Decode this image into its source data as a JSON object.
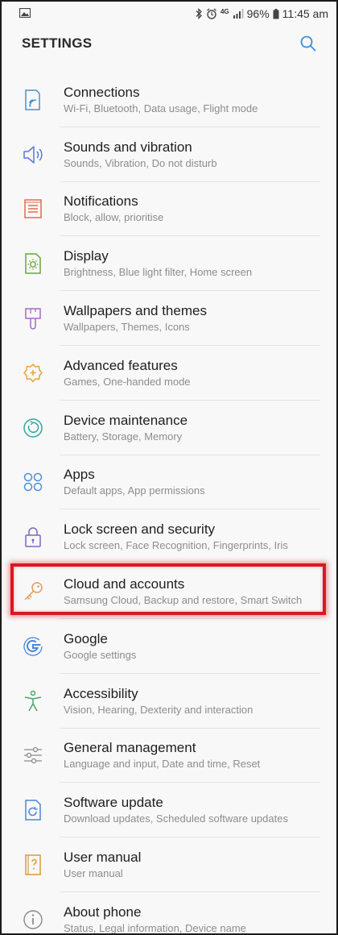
{
  "status_bar": {
    "network": "4G",
    "battery": "96%",
    "time": "11:45 am"
  },
  "header": {
    "title": "SETTINGS"
  },
  "items": [
    {
      "title": "Connections",
      "subtitle": "Wi-Fi, Bluetooth, Data usage, Flight mode",
      "icon": "connections-icon",
      "color": "#4a8fd0"
    },
    {
      "title": "Sounds and vibration",
      "subtitle": "Sounds, Vibration, Do not disturb",
      "icon": "speaker-icon",
      "color": "#5b78d6"
    },
    {
      "title": "Notifications",
      "subtitle": "Block, allow, prioritise",
      "icon": "notifications-icon",
      "color": "#e36c4d"
    },
    {
      "title": "Display",
      "subtitle": "Brightness, Blue light filter, Home screen",
      "icon": "display-icon",
      "color": "#6aa53b"
    },
    {
      "title": "Wallpapers and themes",
      "subtitle": "Wallpapers, Themes, Icons",
      "icon": "brush-icon",
      "color": "#a56bc4"
    },
    {
      "title": "Advanced features",
      "subtitle": "Games, One-handed mode",
      "icon": "gear-plus-icon",
      "color": "#e9a23b"
    },
    {
      "title": "Device maintenance",
      "subtitle": "Battery, Storage, Memory",
      "icon": "maintenance-icon",
      "color": "#35a59a"
    },
    {
      "title": "Apps",
      "subtitle": "Default apps, App permissions",
      "icon": "apps-icon",
      "color": "#4f8fd6"
    },
    {
      "title": "Lock screen and security",
      "subtitle": "Lock screen, Face Recognition, Fingerprints, Iris",
      "icon": "lock-icon",
      "color": "#7e67c2"
    },
    {
      "title": "Cloud and accounts",
      "subtitle": "Samsung Cloud, Backup and restore, Smart Switch",
      "icon": "key-icon",
      "color": "#e39a5b"
    },
    {
      "title": "Google",
      "subtitle": "Google settings",
      "icon": "google-icon",
      "color": "#4f86d8"
    },
    {
      "title": "Accessibility",
      "subtitle": "Vision, Hearing, Dexterity and interaction",
      "icon": "accessibility-icon",
      "color": "#49a86a"
    },
    {
      "title": "General management",
      "subtitle": "Language and input, Date and time, Reset",
      "icon": "sliders-icon",
      "color": "#8a8a8a"
    },
    {
      "title": "Software update",
      "subtitle": "Download updates, Scheduled software updates",
      "icon": "update-icon",
      "color": "#4f86d8"
    },
    {
      "title": "User manual",
      "subtitle": "User manual",
      "icon": "manual-icon",
      "color": "#d99a3a"
    },
    {
      "title": "About phone",
      "subtitle": "Status, Legal information, Device name",
      "icon": "info-icon",
      "color": "#8a8a8a"
    }
  ],
  "accent_color": "#3a8fd8",
  "highlight_color": "#d81920"
}
